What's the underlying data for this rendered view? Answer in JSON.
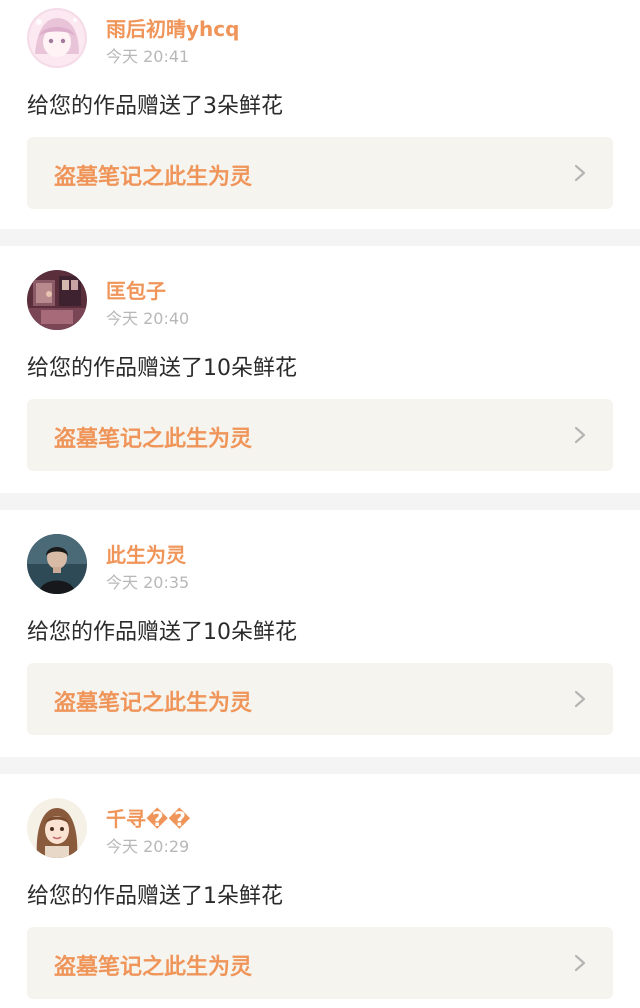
{
  "notifications": [
    {
      "username": "雨后初晴yhcq",
      "time": "今天 20:41",
      "message": "给您的作品赠送了3朵鲜花",
      "work_title": "盗墓笔记之此生为灵",
      "avatar": "anime-girl-pink-avatar"
    },
    {
      "username": "匡包子",
      "time": "今天 20:40",
      "message": "给您的作品赠送了10朵鲜花",
      "work_title": "盗墓笔记之此生为灵",
      "avatar": "room-scene-avatar"
    },
    {
      "username": "此生为灵",
      "time": "今天 20:35",
      "message": "给您的作品赠送了10朵鲜花",
      "work_title": "盗墓笔记之此生为灵",
      "avatar": "boy-dark-avatar"
    },
    {
      "username": "千寻��",
      "time": "今天 20:29",
      "message": "给您的作品赠送了1朵鲜花",
      "work_title": "盗墓笔记之此生为灵",
      "avatar": "anime-girl-brown-hair-avatar"
    }
  ],
  "icons": {
    "chevron": "chevron-right-icon"
  },
  "colors": {
    "accent": "#f0955a",
    "text": "#2b2b2b",
    "muted": "#b8b8b8",
    "card_link_bg": "#f5f4ee",
    "separator": "#f4f4f4"
  }
}
